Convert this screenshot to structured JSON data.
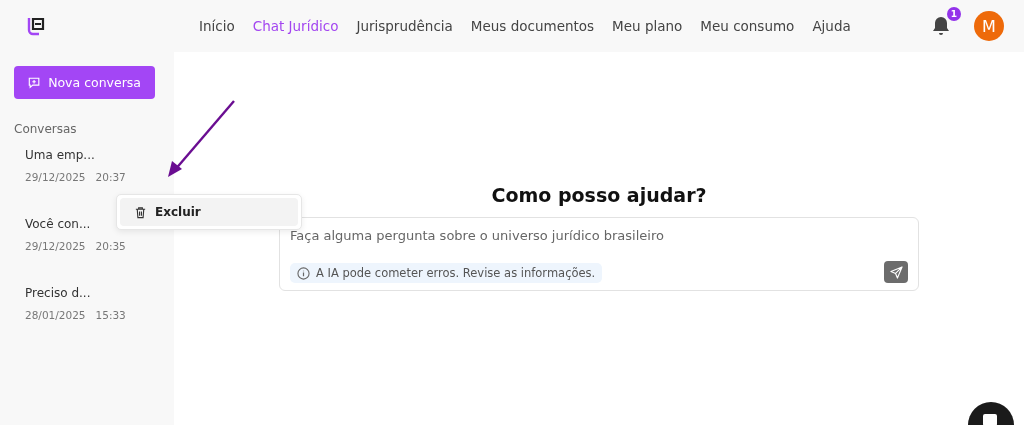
{
  "header": {
    "nav": [
      {
        "label": "Início",
        "selected": false
      },
      {
        "label": "Chat Jurídico",
        "selected": true
      },
      {
        "label": "Jurisprudência",
        "selected": false
      },
      {
        "label": "Meus documentos",
        "selected": false
      },
      {
        "label": "Meu plano",
        "selected": false
      },
      {
        "label": "Meu consumo",
        "selected": false
      },
      {
        "label": "Ajuda",
        "selected": false
      }
    ],
    "notification_count": "1",
    "avatar_initial": "M"
  },
  "sidebar": {
    "new_button": "Nova conversa",
    "section_title": "Conversas",
    "conversations": [
      {
        "title": "Uma emp...",
        "date": "29/12/2025",
        "time": "20:37"
      },
      {
        "title": "Você con...",
        "date": "29/12/2025",
        "time": "20:35"
      },
      {
        "title": "Preciso d...",
        "date": "28/01/2025",
        "time": "15:33"
      }
    ]
  },
  "context_menu": {
    "items": [
      "Excluir"
    ]
  },
  "main": {
    "heading": "Como posso ajudar?",
    "input_placeholder": "Faça alguma pergunta sobre o universo jurídico brasileiro",
    "disclaimer": "A IA pode cometer erros. Revise as informações."
  }
}
